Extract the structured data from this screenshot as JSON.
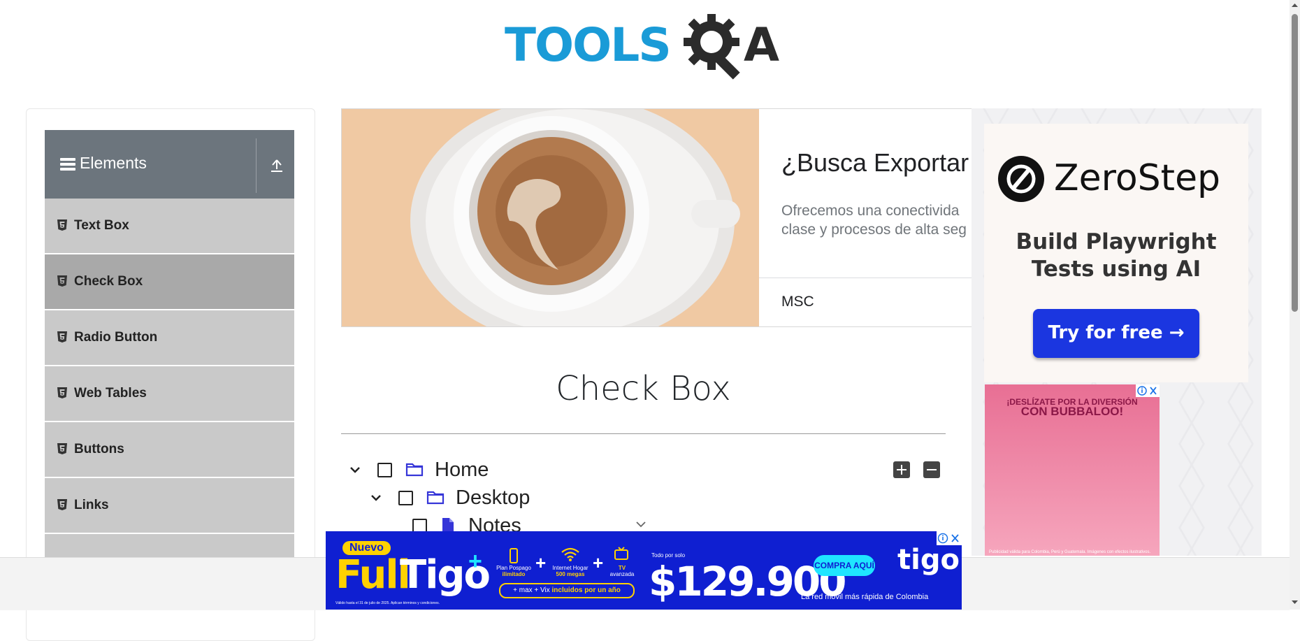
{
  "logo": {
    "text_left": "TOOLS",
    "text_right": "A",
    "colors": {
      "blue": "#1a9bd7",
      "dark": "#2b2b2b"
    }
  },
  "sidebar": {
    "group_title": "Elements",
    "group_icon": "hamburger-icon",
    "collapse_icon": "upload-arrow-icon",
    "items": [
      {
        "label": "Text Box",
        "icon": "html5-icon",
        "active": false
      },
      {
        "label": "Check Box",
        "icon": "html5-icon",
        "active": true
      },
      {
        "label": "Radio Button",
        "icon": "html5-icon",
        "active": false
      },
      {
        "label": "Web Tables",
        "icon": "html5-icon",
        "active": false
      },
      {
        "label": "Buttons",
        "icon": "html5-icon",
        "active": false
      },
      {
        "label": "Links",
        "icon": "html5-icon",
        "active": false
      }
    ]
  },
  "top_ad": {
    "headline": "¿Busca Exportar",
    "body_line1": "Ofrecemos una conectivida",
    "body_line2": "clase y procesos de alta seg",
    "brand": "MSC"
  },
  "main": {
    "title": "Check Box",
    "tree": [
      {
        "label": "Home",
        "icon": "folder-icon",
        "expanded": true
      },
      {
        "label": "Desktop",
        "icon": "folder-icon",
        "expanded": true
      },
      {
        "label": "Notes",
        "icon": "file-icon",
        "expanded": false
      }
    ],
    "expand_all_icon": "plus-square-icon",
    "collapse_all_icon": "minus-square-icon"
  },
  "right_ad": {
    "brand": "ZeroStep",
    "tagline_line1": "Build Playwright",
    "tagline_line2": "Tests using AI",
    "cta": "Try for free →",
    "secondary_line1": "¡DESLÍZATE POR LA DIVERSIÓN",
    "secondary_line2": "CON BUBBALOO!",
    "secondary_fine_print": "Publicidad válida para Colombia, Perú y Guatemala. Imágenes con efectos ilustrativos."
  },
  "bottom_ad": {
    "badge": "Nuevo",
    "headline_a": "Full",
    "headline_b": "Tigo",
    "headline_plus": "+",
    "svc1_a": "Plan Pospago",
    "svc1_b": "ilimitado",
    "svc2_a": "Internet Hogar",
    "svc2_b": "500 megas",
    "svc3_a": "TV",
    "svc3_b": "avanzada",
    "pill_a": "+ max + Vix",
    "pill_b": "incluidos por un año",
    "price_prefix": "Todo por solo",
    "price": "$129.900",
    "cta": "COMPRA AQUÍ",
    "logo": "tigo",
    "slogan": "La red móvil más rápida de Colombia",
    "legal": "Válido hasta el 31 de julio de 2025. Aplican términos y condiciones.",
    "colors": {
      "bg": "#0f1fd1",
      "yellow": "#ffd100",
      "cyan": "#1fe5ff"
    }
  }
}
